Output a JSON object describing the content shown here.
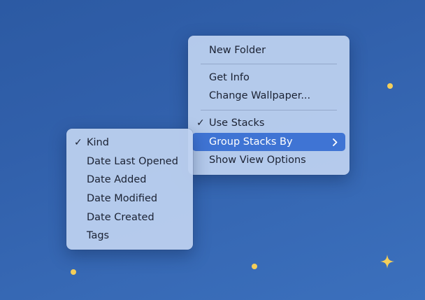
{
  "context_menu": {
    "items": [
      {
        "label": "New Folder"
      },
      {
        "label": "Get Info"
      },
      {
        "label": "Change Wallpaper..."
      },
      {
        "label": "Use Stacks",
        "checkmark": "✓",
        "checked": true
      },
      {
        "label": "Group Stacks By",
        "highlighted": true,
        "submenu_icon": "chevron-right-icon"
      },
      {
        "label": "Show View Options"
      }
    ]
  },
  "submenu": {
    "items": [
      {
        "label": "Kind",
        "checkmark": "✓",
        "checked": true
      },
      {
        "label": "Date Last Opened"
      },
      {
        "label": "Date Added"
      },
      {
        "label": "Date Modified"
      },
      {
        "label": "Date Created"
      },
      {
        "label": "Tags"
      }
    ]
  },
  "colors": {
    "highlight": "#3f74d4",
    "wallpaper": "#3160ab",
    "dots": "#f4cf5a"
  }
}
